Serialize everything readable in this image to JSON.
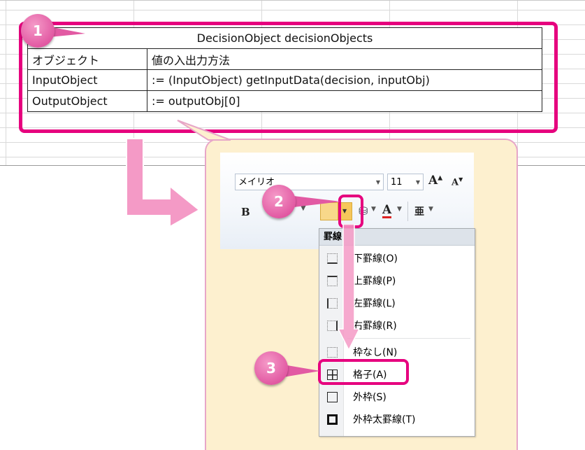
{
  "table": {
    "title": "DecisionObject decisionObjects",
    "rows": [
      {
        "col1": "オブジェクト",
        "col2": "値の入出力方法"
      },
      {
        "col1": "InputObject",
        "col2": ":= (InputObject) getInputData(decision, inputObj)"
      },
      {
        "col1": "OutputObject",
        "col2": ":= outputObj[0]"
      }
    ]
  },
  "badges": {
    "one": "1",
    "two": "2",
    "three": "3"
  },
  "ribbon": {
    "font_name": "メイリオ",
    "font_size": "11",
    "grow_font": "A",
    "shrink_font": "A",
    "bold": "B",
    "font_color": "A",
    "phonetic": "亜"
  },
  "menu": {
    "header": "罫線",
    "items": [
      {
        "label": "下罫線(O)",
        "icon": "bottom-border-icon"
      },
      {
        "label": "上罫線(P)",
        "icon": "top-border-icon"
      },
      {
        "label": "左罫線(L)",
        "icon": "left-border-icon"
      },
      {
        "label": "右罫線(R)",
        "icon": "right-border-icon"
      },
      {
        "label": "枠なし(N)",
        "icon": "no-border-icon"
      },
      {
        "label": "格子(A)",
        "icon": "all-borders-icon"
      },
      {
        "label": "外枠(S)",
        "icon": "outside-borders-icon"
      },
      {
        "label": "外枠太罫線(T)",
        "icon": "thick-box-border-icon"
      }
    ]
  },
  "colors": {
    "accent": "#e6007e",
    "callout_bg": "#fdf0cf",
    "badge": "#e25aa3"
  }
}
